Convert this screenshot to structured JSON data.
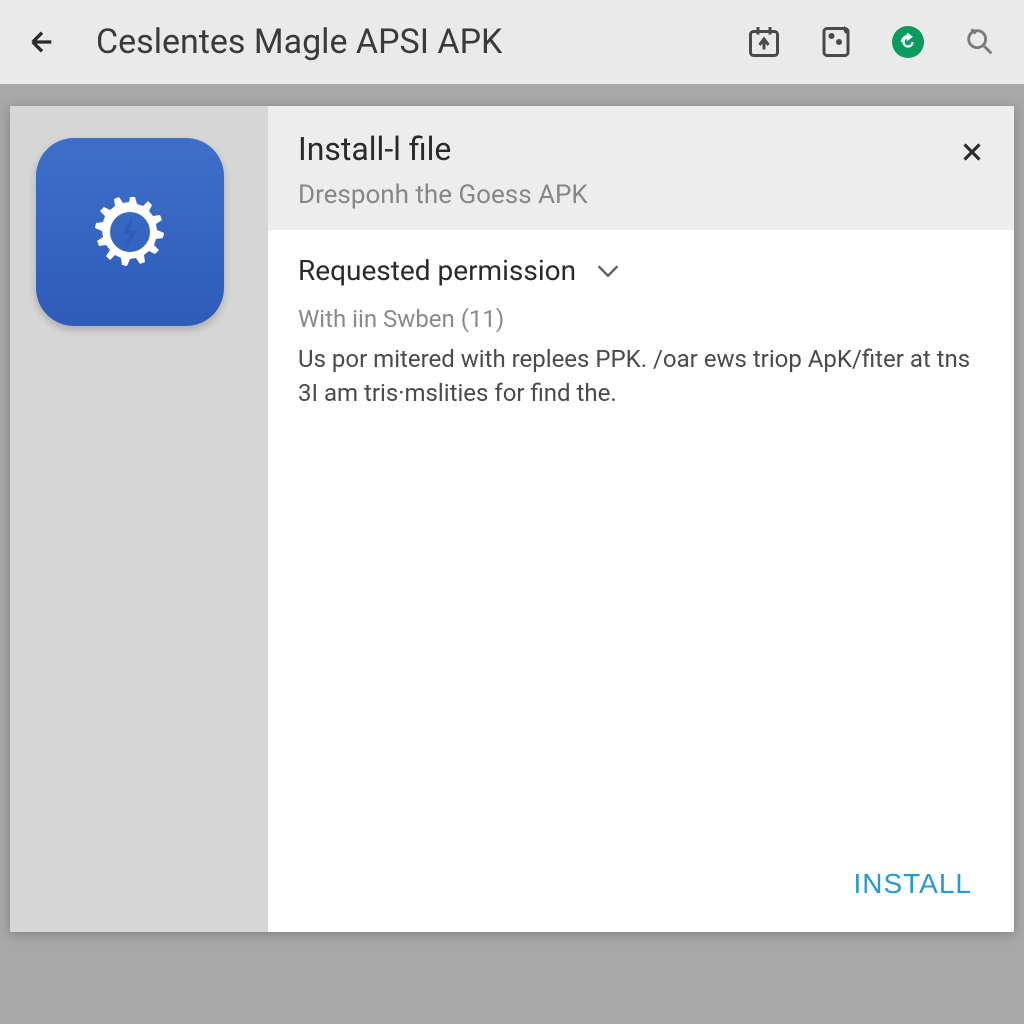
{
  "toolbar": {
    "title": "Ceslentes Magle APSI APK"
  },
  "dialog": {
    "title": "Install-l file",
    "subtitle": "Dresponh the Goess APK",
    "permission": {
      "heading": "Requested permission",
      "count_label": "With iin Swben (11)",
      "description": "Us por mitered with replees PPK. /oar ews triop ApK/fiter at tns 3I am tris·mslities for find the."
    },
    "install_button": "INSTALL"
  }
}
